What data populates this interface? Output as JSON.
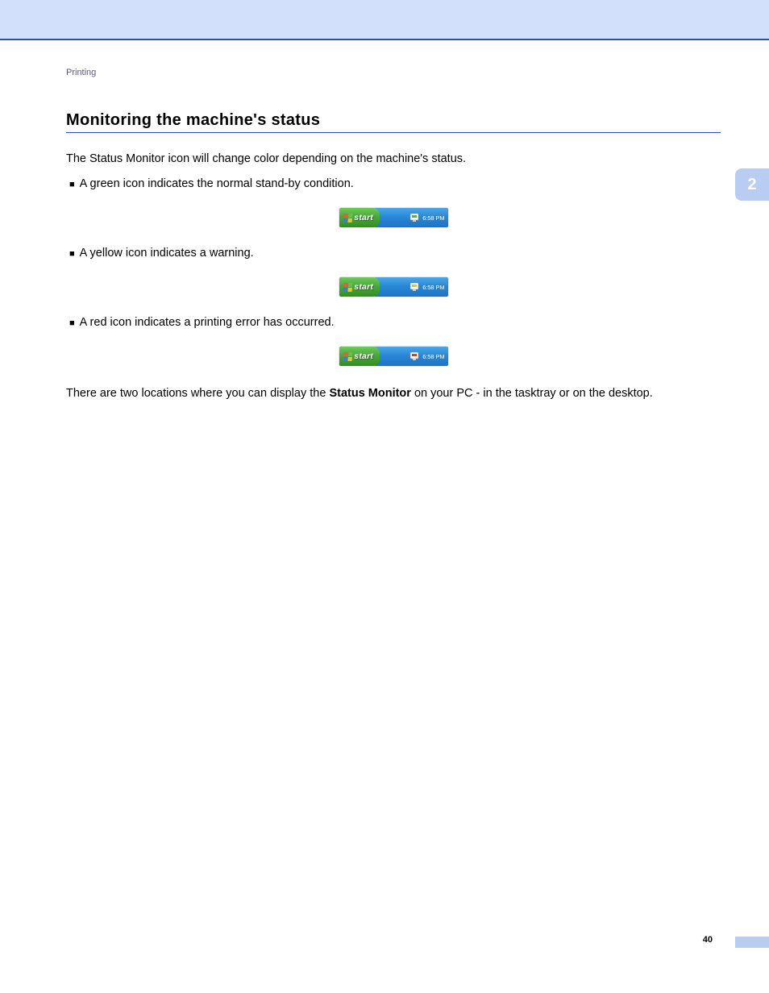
{
  "breadcrumb": "Printing",
  "heading": "Monitoring the machine's status",
  "intro": "The Status Monitor icon will change color depending on the machine's status.",
  "bullets": {
    "green": "A green icon indicates the normal stand-by condition.",
    "yellow": "A yellow icon indicates a warning.",
    "red": "A red icon indicates a printing error has occurred."
  },
  "taskbar": {
    "start_label": "start",
    "time": "6:58 PM"
  },
  "status_colors": {
    "green": "#3fbf3f",
    "yellow": "#e8c22a",
    "red": "#de3a2a"
  },
  "closing_before": "There are two locations where you can display the ",
  "closing_bold": "Status Monitor",
  "closing_after": " on your PC - in the tasktray or on the desktop.",
  "chapter": "2",
  "page_number": "40"
}
